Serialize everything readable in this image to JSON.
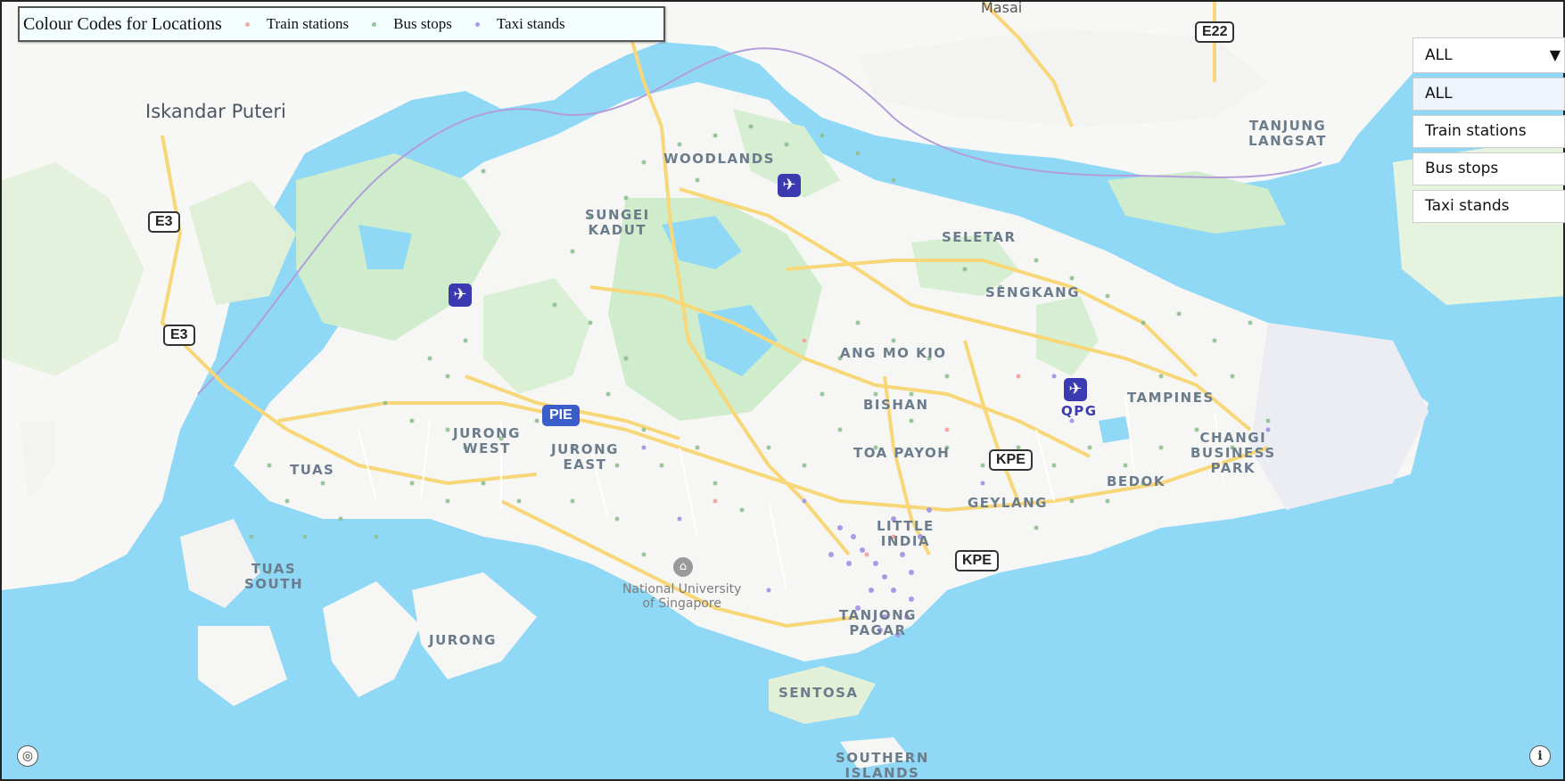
{
  "legend": {
    "title": "Colour Codes for Locations",
    "items": [
      {
        "label": "Train stations",
        "color": "#f4a9a9"
      },
      {
        "label": "Bus stops",
        "color": "#8fc79a"
      },
      {
        "label": "Taxi stands",
        "color": "#a99ae8"
      }
    ]
  },
  "filter": {
    "selected": "ALL",
    "caret": "▼",
    "options": [
      "ALL",
      "Train stations",
      "Bus stops",
      "Taxi stands"
    ]
  },
  "places": {
    "masai": "Masai",
    "iskandar": "Iskandar Puteri",
    "woodlands": "WOODLANDS",
    "sungei_kadut": "SUNGEI\nKADUT",
    "seletar": "SELETAR",
    "sengkang": "SENGKANG",
    "ang_mo_kio": "ANG MO KIO",
    "bishan": "BISHAN",
    "toa_payoh": "TOA PAYOH",
    "jurong_west": "JURONG\nWEST",
    "jurong_east": "JURONG\nEAST",
    "tuas": "TUAS",
    "tuas_south": "TUAS\nSOUTH",
    "jurong": "JURONG",
    "little_india": "LITTLE\nINDIA",
    "geylang": "GEYLANG",
    "tanjong_pagar": "TANJONG\nPAGAR",
    "sentosa": "SENTOSA",
    "southern_islands": "SOUTHERN\nISLANDS",
    "tampines": "TAMPINES",
    "bedok": "BEDOK",
    "changi_bp": "CHANGI\nBUSINESS\nPARK",
    "tanjung_langsat": "TANJUNG\nLANGSAT",
    "qpg": "QPG",
    "nus": "National University\nof Singapore"
  },
  "roads": {
    "e22": "E22",
    "e3a": "E3",
    "e3b": "E3",
    "pie": "PIE",
    "kpe1": "KPE",
    "kpe2": "KPE"
  },
  "icons": {
    "airport": "✈",
    "university": "⌂",
    "compass": "◎",
    "info": "i"
  }
}
